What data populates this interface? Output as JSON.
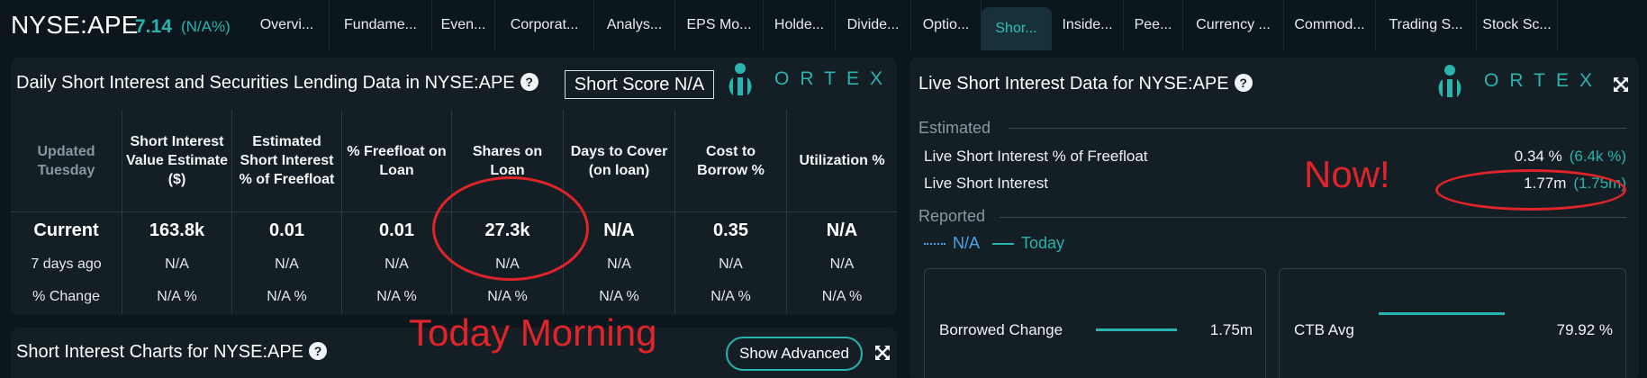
{
  "header": {
    "ticker": "NYSE:APE",
    "price": "7.14",
    "change": "(N/A%)",
    "tabs": [
      {
        "label": "Overvi...",
        "w": 94
      },
      {
        "label": "Fundame...",
        "w": 114
      },
      {
        "label": "Even...",
        "w": 70
      },
      {
        "label": "Corporat...",
        "w": 110
      },
      {
        "label": "Analys...",
        "w": 90
      },
      {
        "label": "EPS Mo...",
        "w": 98
      },
      {
        "label": "Holde...",
        "w": 80
      },
      {
        "label": "Divide...",
        "w": 84
      },
      {
        "label": "Optio...",
        "w": 78
      },
      {
        "label": "Shor...",
        "w": 78,
        "active": true
      },
      {
        "label": "Inside...",
        "w": 80
      },
      {
        "label": "Pee...",
        "w": 66
      },
      {
        "label": "Currency ...",
        "w": 112
      },
      {
        "label": "Commod...",
        "w": 102
      },
      {
        "label": "Trading S...",
        "w": 112
      },
      {
        "label": "Stock Sc...",
        "w": 90
      }
    ]
  },
  "daily_panel": {
    "title": "Daily Short Interest and Securities Lending Data in NYSE:APE",
    "short_score": "Short Score N/A",
    "brand": "ORTEX",
    "columns": [
      {
        "label": "Updated Tuesday"
      },
      {
        "label": "Short Interest Value Estimate ($)"
      },
      {
        "label": "Estimated Short Interest % of Freefloat"
      },
      {
        "label": "% Freefloat on Loan"
      },
      {
        "label": "Shares on Loan"
      },
      {
        "label": "Days to Cover (on loan)"
      },
      {
        "label": "Cost to Borrow %"
      },
      {
        "label": "Utilization %"
      }
    ],
    "rows": [
      [
        "Current",
        "163.8k",
        "0.01",
        "0.01",
        "27.3k",
        "N/A",
        "0.35",
        "N/A"
      ],
      [
        "7 days ago",
        "N/A",
        "N/A",
        "N/A",
        "N/A",
        "N/A",
        "N/A",
        "N/A"
      ],
      [
        "% Change",
        "N/A %",
        "N/A %",
        "N/A %",
        "N/A %",
        "N/A %",
        "N/A %",
        "N/A %"
      ]
    ]
  },
  "live_panel": {
    "title": "Live Short Interest Data for NYSE:APE",
    "brand": "ORTEX",
    "estimated_label": "Estimated",
    "rows": [
      {
        "label": "Live Short Interest % of Freefloat",
        "value": "0.34 %",
        "sub": "(6.4k %)"
      },
      {
        "label": "Live Short Interest",
        "value": "1.77m",
        "sub": "(1.75m)"
      }
    ],
    "reported_label": "Reported",
    "legend_na": "N/A",
    "legend_today": "Today",
    "cards": [
      {
        "label": "Borrowed Change",
        "value": "1.75m"
      },
      {
        "label": "CTB Avg",
        "value": "79.92 %"
      }
    ]
  },
  "charts_panel": {
    "title": "Short Interest Charts for NYSE:APE",
    "show_advanced": "Show Advanced"
  },
  "annotations": {
    "today_morning": "Today Morning",
    "now": "Now!"
  },
  "colors": {
    "accent": "#27b4ac",
    "annotation": "#e0242a",
    "background": "#0c171d",
    "panel": "#141f25"
  }
}
